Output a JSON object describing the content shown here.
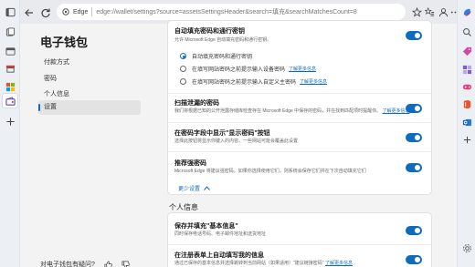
{
  "browser": {
    "edge_label": "Edge",
    "url": "edge://wallet/settings?source=assetsSettingsHeader&search=填充&searchMatchesCount=8"
  },
  "wallet": {
    "title": "电子钱包",
    "nav": [
      "付款方式",
      "密码",
      "个人信息",
      "设置"
    ],
    "active_index": 3,
    "feedback": "对电子钱包有疑问?"
  },
  "settings": {
    "autofill": {
      "title": "自动填充密码和通行密钥",
      "desc": "允许 Microsoft Edge 自动填充密码和通行密钥。",
      "enabled": true
    },
    "radios": [
      {
        "label": "自动填充密码和通行密钥",
        "selected": true,
        "link": ""
      },
      {
        "label": "在填写网站密码之前提示输入设备密码",
        "selected": false,
        "link": "了解更多信息"
      },
      {
        "label": "在填写网站密码之前提示输入自定义主密码",
        "selected": false,
        "link": "了解更多信息"
      }
    ],
    "leaked": {
      "title": "扫描泄漏的密码",
      "desc": "我们将根据已知的公开泄露存储库检查存在 Microsoft Edge 中保存的密码，并在找到匹配项时提醒你。",
      "link": "了解更多信息",
      "enabled": true
    },
    "reveal": {
      "title": "在密码字段中显示\"显示密码\"按钮",
      "desc": "选择此按钮将显示你键入的内容。一些网站可能会覆盖此设置",
      "enabled": true
    },
    "suggest": {
      "title": "推荐强密码",
      "desc": "Microsoft Edge 将建议强密码。如果你选择使用它们，则系统会保存它们并在下次自动填充它们",
      "enabled": true
    },
    "less_label": "更少设置"
  },
  "personal": {
    "section": "个人信息",
    "basic": {
      "title": "保存并填充\"基本信息\"",
      "desc": "同时保存电话号码、电子邮件地址和送货地址",
      "enabled": true
    },
    "forms": {
      "title": "在注册表单上自动填写我的信息",
      "desc": "通过已保存的基本信息并选择跳转到当前网站（如果适用）\"建议链接密码\"",
      "link": "了解更多信息",
      "enabled": true
    }
  },
  "colors": {
    "accent": "#0f6cbd"
  }
}
